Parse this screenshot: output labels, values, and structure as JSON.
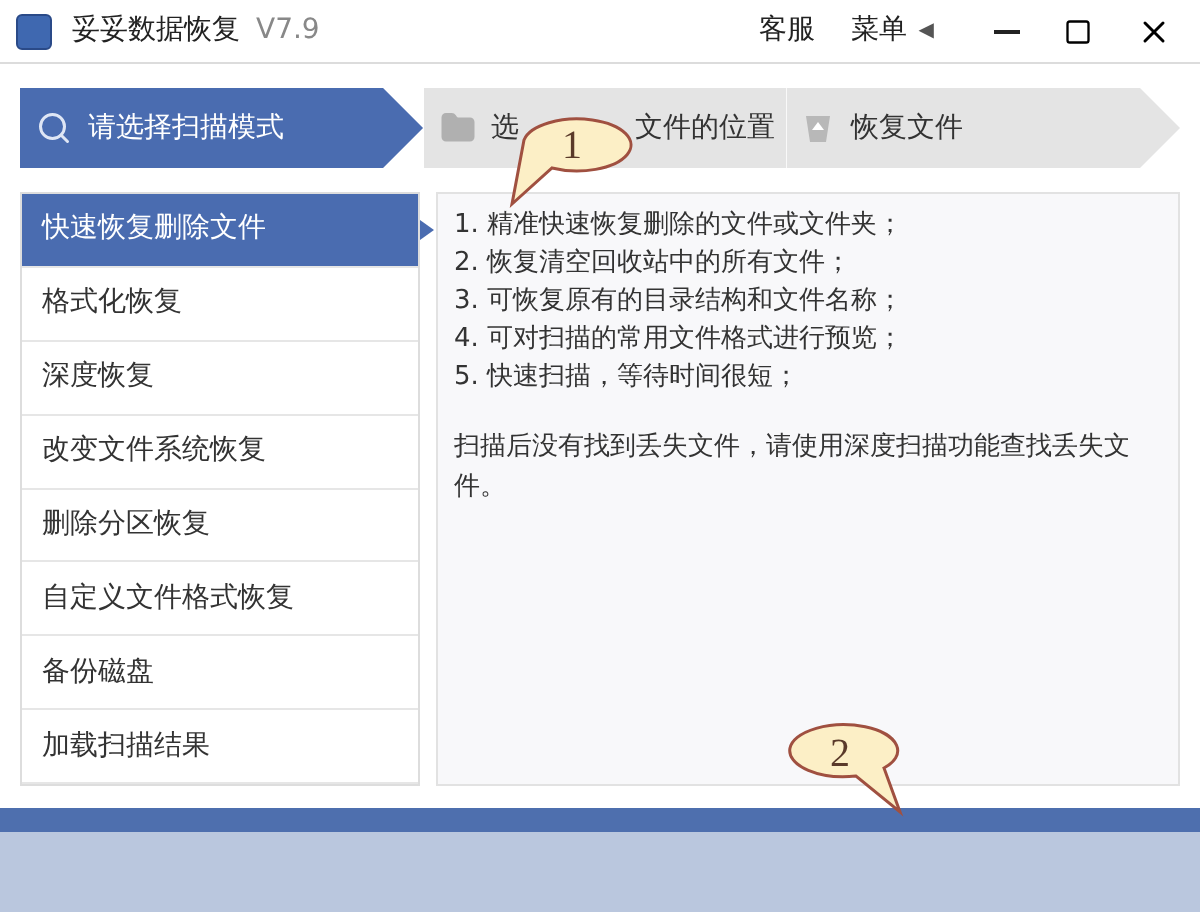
{
  "window": {
    "title": "妥妥数据恢复",
    "version": "V7.9",
    "support": "客服",
    "menu": "菜单",
    "menu_arrow": "◀"
  },
  "steps": [
    {
      "label": "请选择扫描模式",
      "selected": true
    },
    {
      "label_start": "选",
      "label_end": "文件的位置",
      "selected": false
    },
    {
      "label": "恢复文件",
      "selected": false
    }
  ],
  "modes": [
    {
      "label": "快速恢复删除文件",
      "selected": true
    },
    {
      "label": "格式化恢复",
      "selected": false
    },
    {
      "label": "深度恢复",
      "selected": false
    },
    {
      "label": "改变文件系统恢复",
      "selected": false
    },
    {
      "label": "删除分区恢复",
      "selected": false
    },
    {
      "label": "自定义文件格式恢复",
      "selected": false
    },
    {
      "label": "备份磁盘",
      "selected": false
    },
    {
      "label": "加载扫描结果",
      "selected": false
    }
  ],
  "description": {
    "features": [
      "1. 精准快速恢复删除的文件或文件夹；",
      "2. 恢复清空回收站中的所有文件；",
      "3. 可恢复原有的目录结构和文件名称；",
      "4. 可对扫描的常用文件格式进行预览；",
      "5. 快速扫描，等待时间很短；"
    ],
    "note": "扫描后没有找到丢失文件，请使用深度扫描功能查找丢失文件。"
  },
  "callouts": [
    {
      "label": "1"
    },
    {
      "label": "2"
    }
  ]
}
